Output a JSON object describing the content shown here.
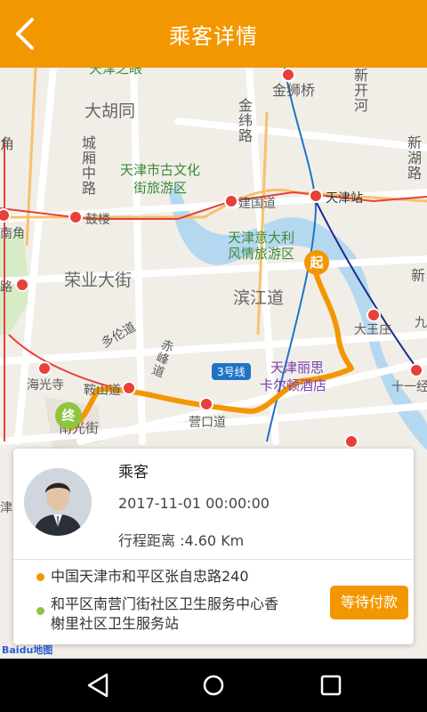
{
  "header": {
    "title": "乘客详情",
    "back_icon": "chevron-left-icon",
    "bg_color": "#f39700"
  },
  "map": {
    "labels": {
      "tianjin_zhiyan": "天津之眼",
      "jinshiqiao": "金狮桥",
      "xinkaihe": "新开河",
      "dahutong": "大胡同",
      "jinweilu": "金纬路",
      "xinzhanlu": "新湖路",
      "jiao": "角",
      "chengxiangzhonglu": "城厢中路",
      "guwenhua_1": "天津市古文化",
      "guwenhua_2": "街旅游区",
      "jianguodao": "建国道",
      "tianjinzhan": "天津站",
      "gulou": "鼓楼",
      "nan": "南角",
      "yidali_1": "天津意大利",
      "yidali_2": "风情旅游区",
      "rongye": "荣业大街",
      "binjiangdao": "滨江道",
      "xin": "新",
      "lu": "路",
      "duolundao": "多伦道",
      "dawanglu": "大王庄",
      "jiu": "九",
      "chichifeng": "赤峰道",
      "line3": "3号线",
      "lisi_1": "天津丽思",
      "lisi_2": "卡尔顿酒店",
      "haiguangsi": "海光寺",
      "anshandao": "鞍山道",
      "yingkoudao": "营口道",
      "shiyijing": "十一经",
      "guangjie": "南光街",
      "jin": "津",
      "start_pin": "起",
      "end_pin": "终"
    },
    "logo": "Baidu地图"
  },
  "passenger": {
    "label": "乘客",
    "datetime": "2017-11-01 00:00:00",
    "distance": "行程距离 :4.60 Km",
    "start_address": "中国天津市和平区张自忠路240",
    "end_address_line1": "和平区南营门街社区卫生服务中心香",
    "end_address_line2": "榭里社区卫生服务站",
    "start_color": "#f39700",
    "end_color": "#8dc63f",
    "pay_button": "等待付款"
  },
  "navbar": {
    "back_icon": "triangle-back-icon",
    "home_icon": "circle-home-icon",
    "recent_icon": "square-recent-icon"
  }
}
